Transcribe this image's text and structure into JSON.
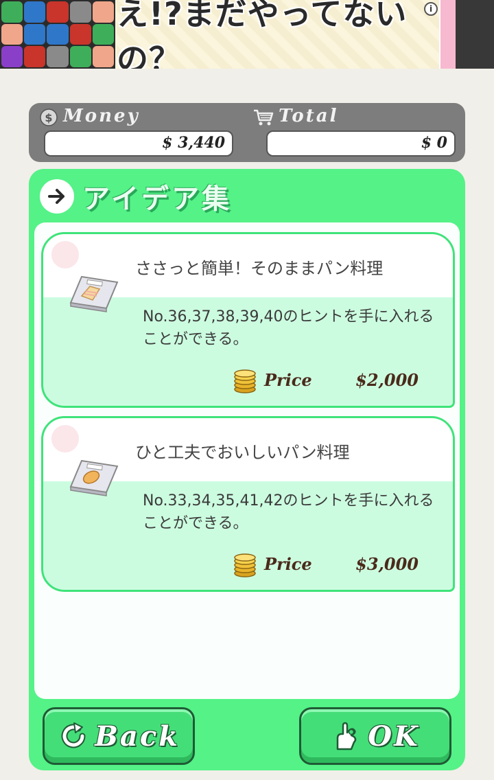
{
  "ad": {
    "headline": "え!?まだやってないの？",
    "info_icon": "info-icon"
  },
  "stats": {
    "money_label": "Money",
    "money_value": "$ 3,440",
    "total_label": "Total",
    "total_value": "$ 0"
  },
  "panel": {
    "title": "アイデア集"
  },
  "items": [
    {
      "title": "ささっと簡単！そのままパン料理",
      "description": "No.36,37,38,39,40のヒントを手に入れることができる。",
      "price_label": "Price",
      "price": "$2,000"
    },
    {
      "title": "ひと工夫でおいしいパン料理",
      "description": "No.33,34,35,41,42のヒントを手に入れることができる。",
      "price_label": "Price",
      "price": "$3,000"
    }
  ],
  "buttons": {
    "back_label": "Back",
    "ok_label": "OK"
  },
  "colors": {
    "panel_green": "#54f287",
    "card_green": "#ccfce0",
    "stats_gray": "#7d7d7d"
  }
}
